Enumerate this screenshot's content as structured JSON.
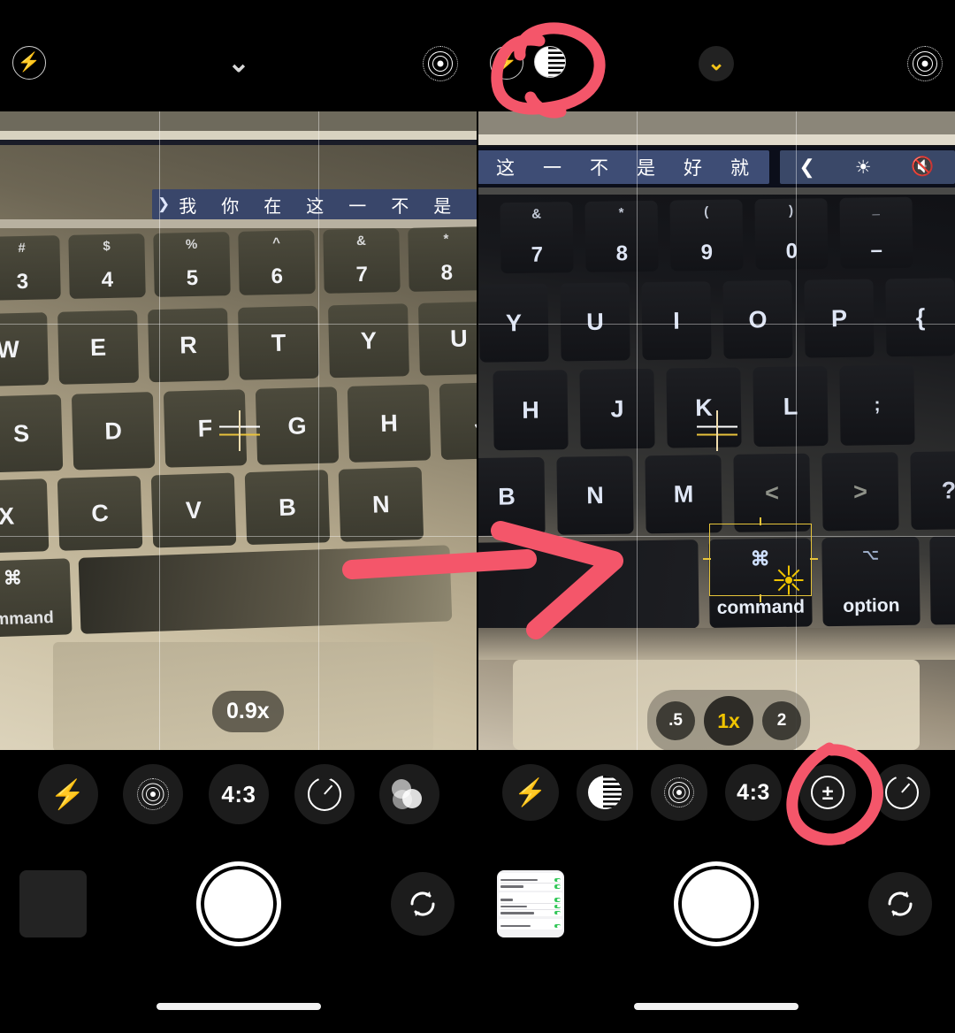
{
  "meta": {
    "app": "iPhone Camera",
    "description": "Side-by-side iPhone camera screenshots comparing Night mode / exposure controls, with red hand-drawn annotations",
    "accent_red": "#f4566a",
    "accent_yellow": "#f0c400"
  },
  "left_panel": {
    "topbar": {
      "flash": {
        "icon": "flash-icon",
        "label": "Flash"
      },
      "chevron": {
        "icon": "chevron-down-icon",
        "state": "collapsed"
      },
      "live_photo": {
        "icon": "live-photo-icon",
        "label": "Live Photo"
      }
    },
    "viewfinder": {
      "touchbar_candidates": [
        "我",
        "你",
        "在",
        "这",
        "一",
        "不",
        "是"
      ],
      "key_rows": [
        [
          "3",
          "4",
          "5",
          "6",
          "7",
          "8"
        ],
        [
          "W",
          "E",
          "R",
          "T",
          "Y",
          "U"
        ],
        [
          "S",
          "D",
          "F",
          "G",
          "H",
          "J"
        ],
        [
          "X",
          "C",
          "V",
          "B",
          "N"
        ]
      ],
      "number_shifts": [
        "#",
        "$",
        "%",
        "^",
        "&",
        "*"
      ],
      "modifier_key": "command",
      "zoom_indicator": "0.9x"
    },
    "controls": [
      {
        "name": "flash-toggle",
        "icon": "flash-icon",
        "label": ""
      },
      {
        "name": "live-photo-toggle",
        "icon": "live-photo-icon",
        "label": ""
      },
      {
        "name": "aspect-ratio-button",
        "icon": "ratio-icon",
        "label": "4:3"
      },
      {
        "name": "timer-button",
        "icon": "timer-icon",
        "label": ""
      },
      {
        "name": "filters-button",
        "icon": "filters-icon",
        "label": ""
      }
    ],
    "shutter": {
      "label": "Shutter"
    },
    "thumbnail": {
      "label": "Last photo",
      "empty": true
    },
    "flip_camera": {
      "icon": "camera-flip-icon",
      "label": "Flip camera"
    }
  },
  "right_panel": {
    "topbar": {
      "flash": {
        "icon": "flash-icon",
        "label": "Flash"
      },
      "night_mode": {
        "icon": "night-mode-icon",
        "label": "Night mode",
        "annotated": true
      },
      "chevron": {
        "icon": "chevron-down-icon",
        "state": "expanded",
        "color": "#f0c400"
      },
      "live_photo": {
        "icon": "live-photo-icon",
        "label": "Live Photo"
      }
    },
    "viewfinder": {
      "touchbar_candidates": [
        "这",
        "一",
        "不",
        "是",
        "好",
        "就"
      ],
      "touchbar_controls": [
        "‹",
        "brightness-icon",
        "mute-icon"
      ],
      "key_rows": [
        [
          "7",
          "8",
          "9",
          "0",
          "–"
        ],
        [
          "Y",
          "U",
          "I",
          "O",
          "P",
          "{"
        ],
        [
          "H",
          "J",
          "K",
          "L",
          ";"
        ],
        [
          "B",
          "N",
          "M",
          "<",
          ">",
          "?"
        ]
      ],
      "number_shifts": [
        "&",
        "*",
        "(",
        ")",
        "_"
      ],
      "modifier_keys": [
        "command",
        "option"
      ],
      "focus_box": {
        "label": "AE/AF focus",
        "exposure_marker": "sun-slider-icon"
      },
      "zoom_options": [
        {
          "label": ".5",
          "selected": false
        },
        {
          "label": "1x",
          "selected": true
        },
        {
          "label": "2",
          "selected": false
        }
      ]
    },
    "controls": [
      {
        "name": "flash-toggle",
        "icon": "flash-icon",
        "label": ""
      },
      {
        "name": "night-mode-toggle",
        "icon": "night-mode-icon",
        "label": ""
      },
      {
        "name": "live-photo-toggle",
        "icon": "live-photo-icon",
        "label": ""
      },
      {
        "name": "aspect-ratio-button",
        "icon": "ratio-icon",
        "label": "4:3"
      },
      {
        "name": "exposure-button",
        "icon": "exposure-plus-minus-icon",
        "label": "±",
        "annotated": true
      },
      {
        "name": "timer-button",
        "icon": "timer-icon",
        "label": ""
      }
    ],
    "shutter": {
      "label": "Shutter"
    },
    "thumbnail": {
      "label": "Last photo",
      "content": "settings list with green toggles"
    },
    "flip_camera": {
      "icon": "camera-flip-icon",
      "label": "Flip camera"
    }
  },
  "annotations": [
    {
      "name": "circle-night-mode",
      "shape": "hand-drawn-circle",
      "target": "night-mode top bar icon"
    },
    {
      "name": "arrow-left-to-right",
      "shape": "hand-drawn-arrow",
      "target": "points from left screenshot to right screenshot"
    },
    {
      "name": "circle-exposure",
      "shape": "hand-drawn-circle",
      "target": "exposure ± control button"
    }
  ]
}
